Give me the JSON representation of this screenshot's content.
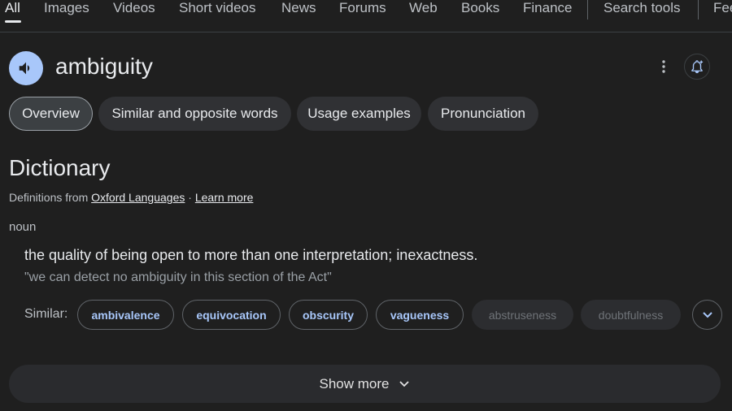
{
  "nav": {
    "tabs": [
      "All",
      "Images",
      "Videos",
      "Short videos",
      "News",
      "Forums",
      "Web",
      "Books",
      "Finance"
    ],
    "search_tools": "Search tools",
    "feedback": "Fee"
  },
  "header": {
    "speaker_icon": "volume-icon",
    "word": "ambiguity",
    "menu_icon": "more-vert-icon",
    "alert_icon": "bell-plus-icon"
  },
  "chips": [
    "Overview",
    "Similar and opposite words",
    "Usage examples",
    "Pronunciation"
  ],
  "dictionary": {
    "title": "Dictionary",
    "source_prefix": "Definitions from ",
    "source_link": "Oxford Languages",
    "source_sep": " · ",
    "learn_more": "Learn more",
    "part_of_speech": "noun",
    "definition": "the quality of being open to more than one interpretation; inexactness.",
    "example": "\"we can detect no ambiguity in this section of the Act\"",
    "similar_label": "Similar:",
    "similar": [
      "ambivalence",
      "equivocation",
      "obscurity",
      "vagueness"
    ],
    "similar_dim": [
      "abstruseness",
      "doubtfulness"
    ],
    "expand_icon": "chevron-down-icon"
  },
  "show_more": {
    "label": "Show more",
    "icon": "chevron-down-icon"
  },
  "colors": {
    "background": "#1f1f1f",
    "accent": "#a8c7fa",
    "chip": "#303134"
  }
}
